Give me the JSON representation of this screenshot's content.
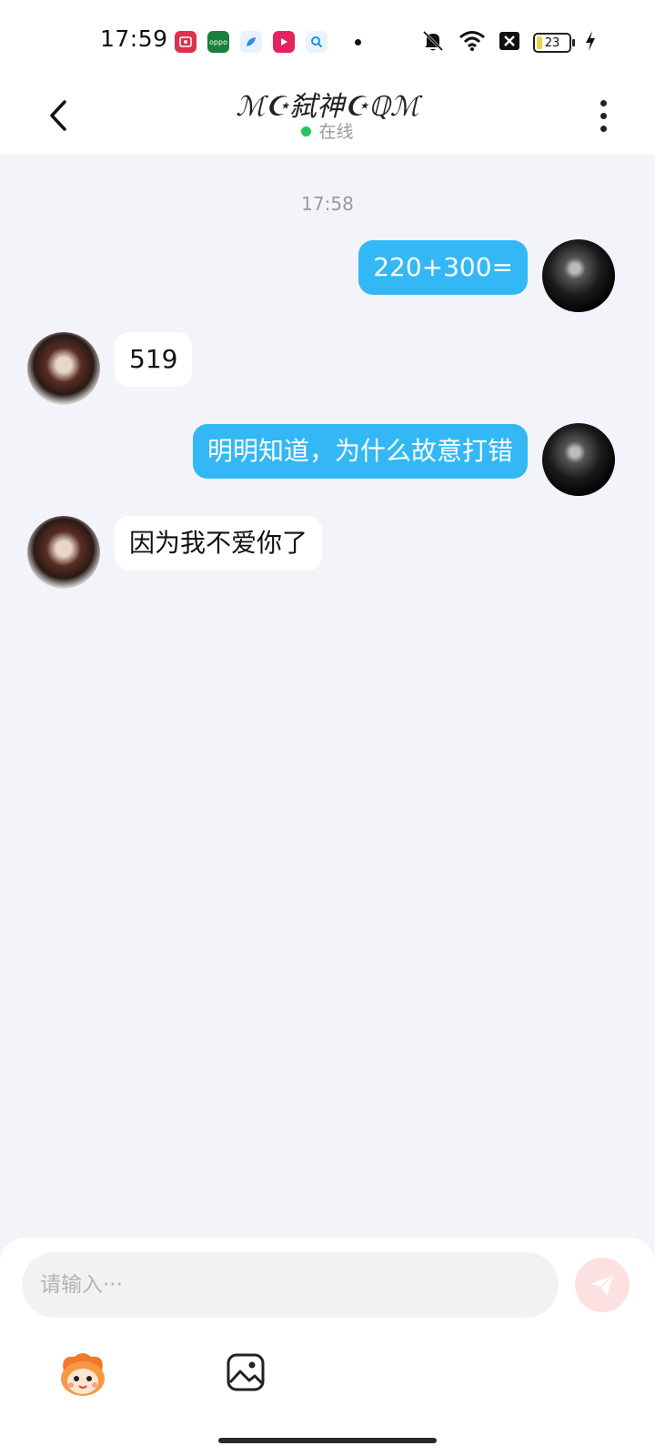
{
  "status_bar": {
    "time": "17:59",
    "apps": [
      {
        "icon": "screen-recorder-icon",
        "color": "#e0304d",
        "label": ""
      },
      {
        "icon": "oppo-icon",
        "color": "#1a7f3b",
        "label": "oppo"
      },
      {
        "icon": "feather-app-icon",
        "color": "#2f8de4",
        "label": ""
      },
      {
        "icon": "video-app-icon",
        "color": "#e3245e",
        "label": ""
      },
      {
        "icon": "search-app-icon",
        "color": "#1a8fe0",
        "label": ""
      }
    ],
    "battery": "23"
  },
  "header": {
    "title": "ℳ☪弑神☪ℚℳ",
    "status": "在线"
  },
  "chat": {
    "timestamp": "17:58",
    "messages": [
      {
        "sender": "self",
        "text": "220+300="
      },
      {
        "sender": "other",
        "text": "519"
      },
      {
        "sender": "self",
        "text": "明明知道，为什么故意打错"
      },
      {
        "sender": "other",
        "text": "因为我不爱你了"
      }
    ]
  },
  "input": {
    "placeholder": "请输入···",
    "value": ""
  },
  "toolbar": {
    "emoji_icon": "mascot-emoji-icon",
    "image_icon": "image-icon"
  },
  "colors": {
    "self_bubble": "#33b8f5",
    "other_bubble": "#ffffff",
    "online_dot": "#22c55e",
    "send_button": "#fde1e1"
  }
}
